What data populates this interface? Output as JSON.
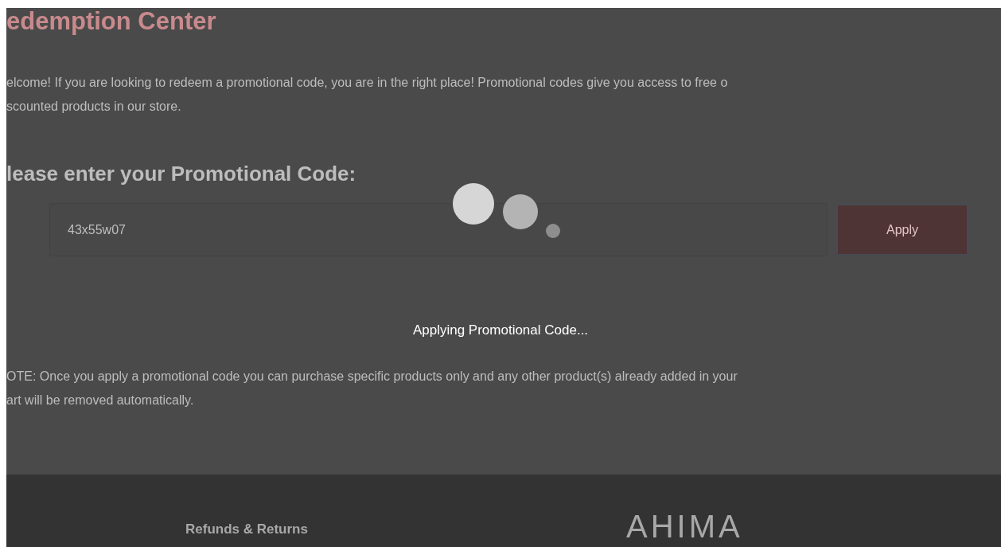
{
  "page": {
    "title": "edemption Center",
    "intro_lines": [
      "elcome! If you are looking to redeem a promotional code, you are in the right place! Promotional codes give you access to free o",
      "scounted products in our store."
    ],
    "prompt": "lease enter your Promotional Code:",
    "code_field": {
      "value": "43x55w07"
    },
    "apply_button": "Apply",
    "note_lines": [
      "OTE: Once you apply a promotional code you can purchase specific products only and any other product(s) already added in your",
      "art will be removed automatically."
    ]
  },
  "loading_overlay": {
    "message": "Applying Promotional Code..."
  },
  "footer": {
    "links": [
      "Refunds & Returns"
    ],
    "logo": "AHIMA"
  }
}
